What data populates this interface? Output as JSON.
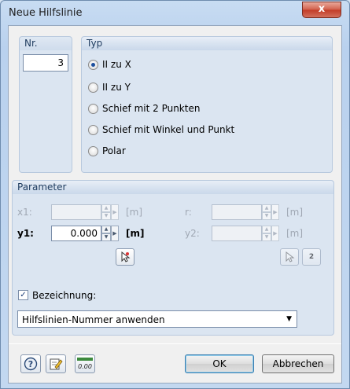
{
  "window": {
    "title": "Neue Hilfslinie",
    "close_label": "x"
  },
  "nr": {
    "title": "Nr.",
    "value": "3"
  },
  "typ": {
    "title": "Typ",
    "options": [
      {
        "label": "II zu X",
        "checked": true
      },
      {
        "label": "II zu Y",
        "checked": false
      },
      {
        "label": "Schief mit 2 Punkten",
        "checked": false
      },
      {
        "label": "Schief mit Winkel und Punkt",
        "checked": false
      },
      {
        "label": "Polar",
        "checked": false
      }
    ]
  },
  "parameter": {
    "title": "Parameter",
    "x1": {
      "label": "x1:",
      "value": "",
      "unit": "[m]",
      "enabled": false
    },
    "y1": {
      "label": "y1:",
      "value": "0.000",
      "unit": "[m]",
      "enabled": true
    },
    "r": {
      "label": "r:",
      "value": "",
      "unit": "[m]",
      "enabled": false
    },
    "y2": {
      "label": "y2:",
      "value": "",
      "unit": "[m]",
      "enabled": false
    },
    "bezeichnung": {
      "label": "Bezeichnung:",
      "checked": true
    },
    "combo_value": "Hilfslinien-Nummer anwenden"
  },
  "buttons": {
    "ok": "OK",
    "cancel": "Abbrechen",
    "pick_2_label": "2"
  },
  "icons": {
    "help": "help-icon",
    "edit": "edit-icon",
    "units": "units-icon",
    "units_text": "0.00"
  }
}
